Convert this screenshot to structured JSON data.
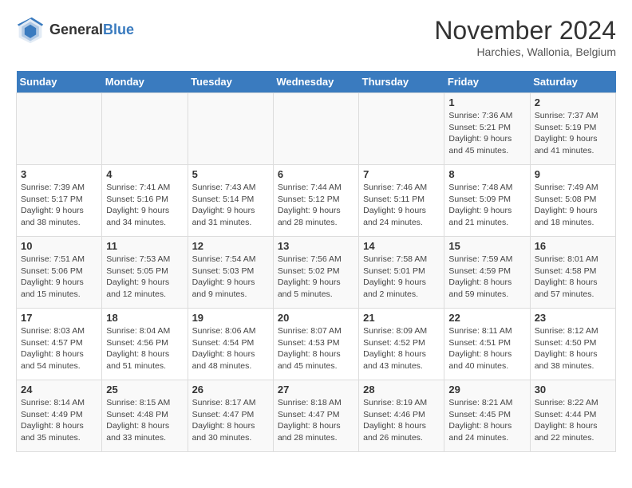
{
  "header": {
    "logo_general": "General",
    "logo_blue": "Blue",
    "month_title": "November 2024",
    "subtitle": "Harchies, Wallonia, Belgium"
  },
  "days_of_week": [
    "Sunday",
    "Monday",
    "Tuesday",
    "Wednesday",
    "Thursday",
    "Friday",
    "Saturday"
  ],
  "weeks": [
    [
      {
        "day": "",
        "info": ""
      },
      {
        "day": "",
        "info": ""
      },
      {
        "day": "",
        "info": ""
      },
      {
        "day": "",
        "info": ""
      },
      {
        "day": "",
        "info": ""
      },
      {
        "day": "1",
        "info": "Sunrise: 7:36 AM\nSunset: 5:21 PM\nDaylight: 9 hours and 45 minutes."
      },
      {
        "day": "2",
        "info": "Sunrise: 7:37 AM\nSunset: 5:19 PM\nDaylight: 9 hours and 41 minutes."
      }
    ],
    [
      {
        "day": "3",
        "info": "Sunrise: 7:39 AM\nSunset: 5:17 PM\nDaylight: 9 hours and 38 minutes."
      },
      {
        "day": "4",
        "info": "Sunrise: 7:41 AM\nSunset: 5:16 PM\nDaylight: 9 hours and 34 minutes."
      },
      {
        "day": "5",
        "info": "Sunrise: 7:43 AM\nSunset: 5:14 PM\nDaylight: 9 hours and 31 minutes."
      },
      {
        "day": "6",
        "info": "Sunrise: 7:44 AM\nSunset: 5:12 PM\nDaylight: 9 hours and 28 minutes."
      },
      {
        "day": "7",
        "info": "Sunrise: 7:46 AM\nSunset: 5:11 PM\nDaylight: 9 hours and 24 minutes."
      },
      {
        "day": "8",
        "info": "Sunrise: 7:48 AM\nSunset: 5:09 PM\nDaylight: 9 hours and 21 minutes."
      },
      {
        "day": "9",
        "info": "Sunrise: 7:49 AM\nSunset: 5:08 PM\nDaylight: 9 hours and 18 minutes."
      }
    ],
    [
      {
        "day": "10",
        "info": "Sunrise: 7:51 AM\nSunset: 5:06 PM\nDaylight: 9 hours and 15 minutes."
      },
      {
        "day": "11",
        "info": "Sunrise: 7:53 AM\nSunset: 5:05 PM\nDaylight: 9 hours and 12 minutes."
      },
      {
        "day": "12",
        "info": "Sunrise: 7:54 AM\nSunset: 5:03 PM\nDaylight: 9 hours and 9 minutes."
      },
      {
        "day": "13",
        "info": "Sunrise: 7:56 AM\nSunset: 5:02 PM\nDaylight: 9 hours and 5 minutes."
      },
      {
        "day": "14",
        "info": "Sunrise: 7:58 AM\nSunset: 5:01 PM\nDaylight: 9 hours and 2 minutes."
      },
      {
        "day": "15",
        "info": "Sunrise: 7:59 AM\nSunset: 4:59 PM\nDaylight: 8 hours and 59 minutes."
      },
      {
        "day": "16",
        "info": "Sunrise: 8:01 AM\nSunset: 4:58 PM\nDaylight: 8 hours and 57 minutes."
      }
    ],
    [
      {
        "day": "17",
        "info": "Sunrise: 8:03 AM\nSunset: 4:57 PM\nDaylight: 8 hours and 54 minutes."
      },
      {
        "day": "18",
        "info": "Sunrise: 8:04 AM\nSunset: 4:56 PM\nDaylight: 8 hours and 51 minutes."
      },
      {
        "day": "19",
        "info": "Sunrise: 8:06 AM\nSunset: 4:54 PM\nDaylight: 8 hours and 48 minutes."
      },
      {
        "day": "20",
        "info": "Sunrise: 8:07 AM\nSunset: 4:53 PM\nDaylight: 8 hours and 45 minutes."
      },
      {
        "day": "21",
        "info": "Sunrise: 8:09 AM\nSunset: 4:52 PM\nDaylight: 8 hours and 43 minutes."
      },
      {
        "day": "22",
        "info": "Sunrise: 8:11 AM\nSunset: 4:51 PM\nDaylight: 8 hours and 40 minutes."
      },
      {
        "day": "23",
        "info": "Sunrise: 8:12 AM\nSunset: 4:50 PM\nDaylight: 8 hours and 38 minutes."
      }
    ],
    [
      {
        "day": "24",
        "info": "Sunrise: 8:14 AM\nSunset: 4:49 PM\nDaylight: 8 hours and 35 minutes."
      },
      {
        "day": "25",
        "info": "Sunrise: 8:15 AM\nSunset: 4:48 PM\nDaylight: 8 hours and 33 minutes."
      },
      {
        "day": "26",
        "info": "Sunrise: 8:17 AM\nSunset: 4:47 PM\nDaylight: 8 hours and 30 minutes."
      },
      {
        "day": "27",
        "info": "Sunrise: 8:18 AM\nSunset: 4:47 PM\nDaylight: 8 hours and 28 minutes."
      },
      {
        "day": "28",
        "info": "Sunrise: 8:19 AM\nSunset: 4:46 PM\nDaylight: 8 hours and 26 minutes."
      },
      {
        "day": "29",
        "info": "Sunrise: 8:21 AM\nSunset: 4:45 PM\nDaylight: 8 hours and 24 minutes."
      },
      {
        "day": "30",
        "info": "Sunrise: 8:22 AM\nSunset: 4:44 PM\nDaylight: 8 hours and 22 minutes."
      }
    ]
  ]
}
